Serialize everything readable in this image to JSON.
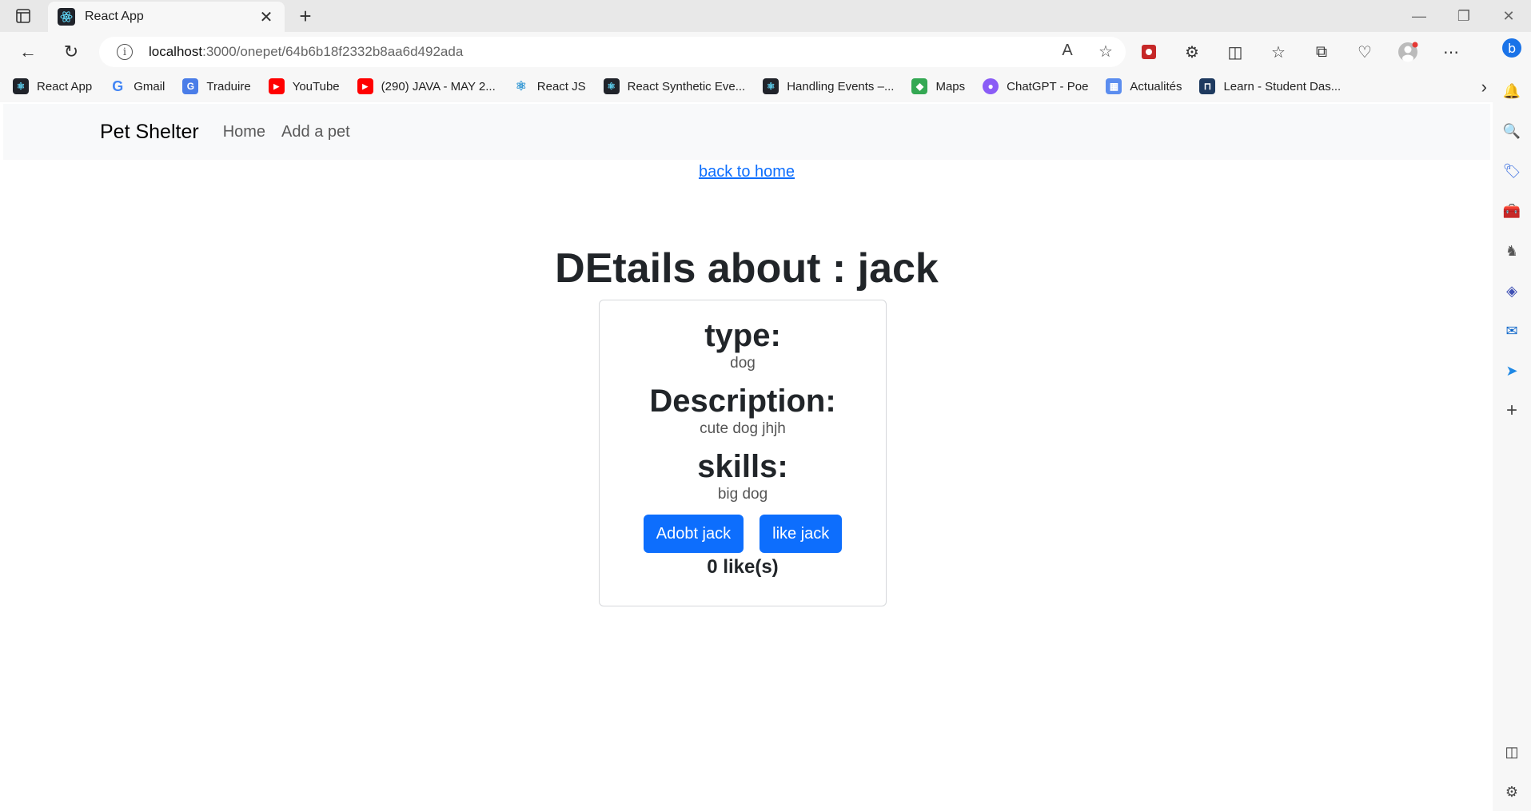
{
  "browser": {
    "tab_title": "React App",
    "url_host": "localhost",
    "url_path": ":3000/onepet/64b6b18f2332b8aa6d492ada",
    "bookmarks": [
      {
        "label": "React App",
        "color": "#20232a"
      },
      {
        "label": "Gmail",
        "color": "#ffffff"
      },
      {
        "label": "Traduire",
        "color": "#4a7de8"
      },
      {
        "label": "YouTube",
        "color": "#ff0000"
      },
      {
        "label": "(290) JAVA - MAY 2...",
        "color": "#ff0000"
      },
      {
        "label": "React JS",
        "color": "#ffffff"
      },
      {
        "label": "React Synthetic Eve...",
        "color": "#20232a"
      },
      {
        "label": "Handling Events –...",
        "color": "#20232a"
      },
      {
        "label": "Maps",
        "color": "#34a853"
      },
      {
        "label": "ChatGPT - Poe",
        "color": "#8a5cf6"
      },
      {
        "label": "Actualités",
        "color": "#5b8def"
      },
      {
        "label": "Learn - Student Das...",
        "color": "#1e3a5f"
      }
    ]
  },
  "app": {
    "brand": "Pet Shelter",
    "nav": {
      "home": "Home",
      "add": "Add a pet"
    },
    "back_link": "back to home",
    "heading": "DEtails about : jack",
    "card": {
      "type_label": "type:",
      "type_value": "dog",
      "desc_label": "Description:",
      "desc_value": "cute dog jhjh",
      "skills_label": "skills:",
      "skills_value": "big dog",
      "adopt_button": "Adobt jack",
      "like_button": "like jack",
      "likes": "0 like(s)"
    }
  }
}
